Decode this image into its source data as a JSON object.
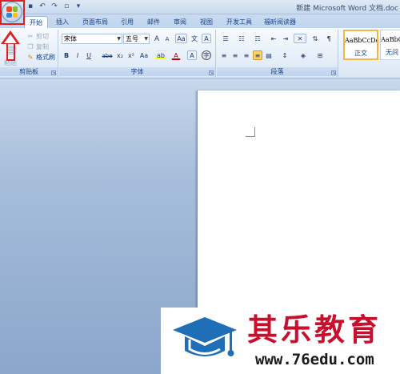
{
  "window": {
    "title": "新建 Microsoft Word 文档.doc"
  },
  "quick_access": [
    {
      "icon": "save-icon",
      "glyph": "▪"
    },
    {
      "icon": "undo-icon",
      "glyph": "↶"
    },
    {
      "icon": "redo-icon",
      "glyph": "↷"
    },
    {
      "icon": "print-preview-icon",
      "glyph": "▫"
    },
    {
      "icon": "customize-qat-icon",
      "glyph": "▾"
    }
  ],
  "tabs": [
    "开始",
    "插入",
    "页面布局",
    "引用",
    "邮件",
    "审阅",
    "视图",
    "开发工具",
    "福昕阅读器"
  ],
  "clipboard": {
    "label": "剪贴板",
    "paste_label": "粘贴",
    "cut": "剪切",
    "copy": "复制",
    "format_painter": "格式刷"
  },
  "font": {
    "label": "字体",
    "font_name": "宋体",
    "font_size": "五号",
    "grow": "A",
    "shrink": "A",
    "clear_format": "Aa",
    "char_border": "A",
    "bold": "B",
    "italic": "I",
    "underline": "U",
    "strikethrough": "abe",
    "subscript": "x₂",
    "superscript": "x²",
    "change_case": "Aa",
    "highlight": "ab",
    "font_color": "A",
    "enclose": "字"
  },
  "paragraph": {
    "label": "段落"
  },
  "styles": {
    "items": [
      {
        "sample": "AaBbCcDc",
        "name": "正文",
        "selected": true
      },
      {
        "sample": "AaBbC",
        "name": "无间",
        "selected": false
      }
    ]
  },
  "watermark": {
    "brand": "其乐教育",
    "url": "www.76edu.com"
  },
  "colors": {
    "highlight_red": "#e02020",
    "brand_red": "#c8102e",
    "ribbon_text": "#15428b",
    "cap_blue": "#1f6fb8"
  }
}
